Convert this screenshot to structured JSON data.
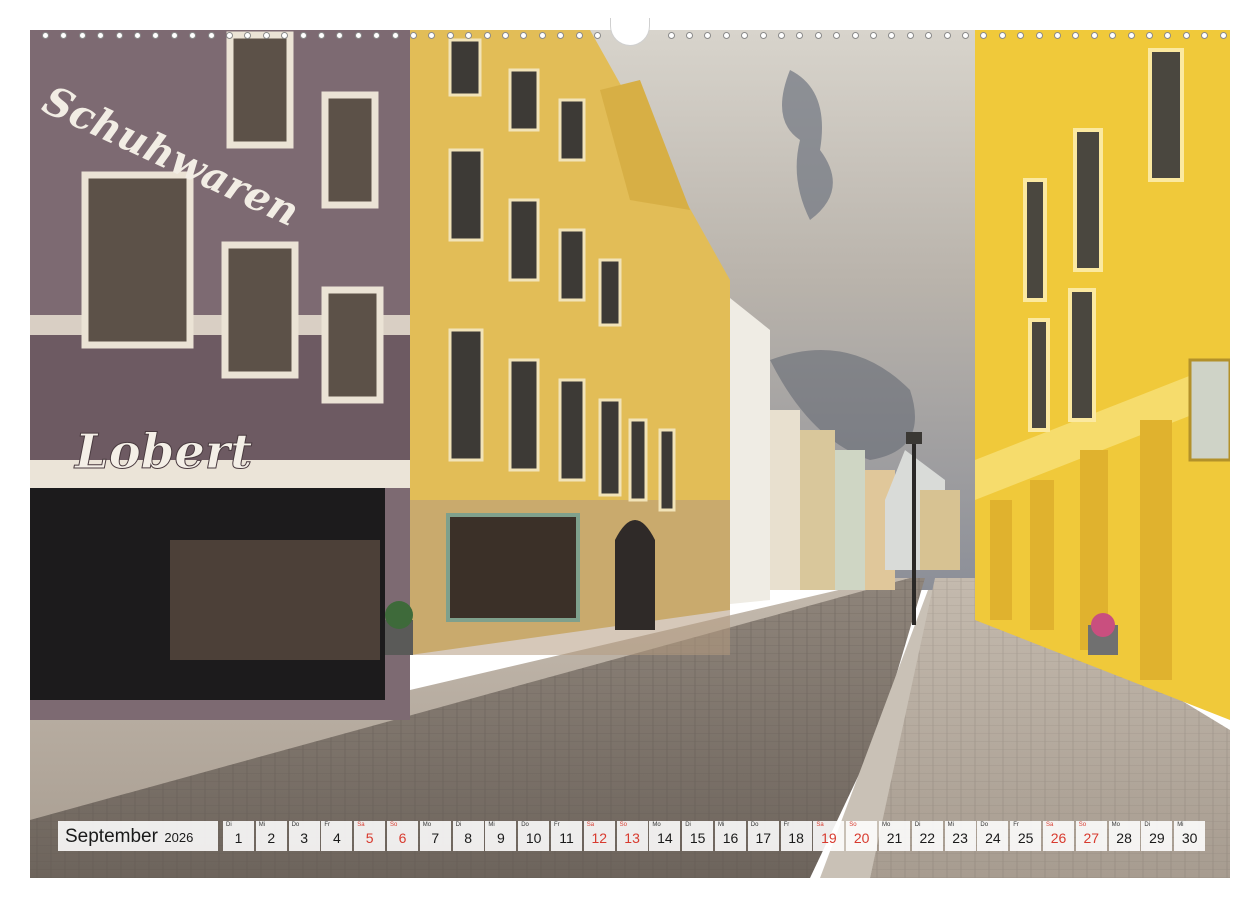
{
  "photo": {
    "description_label": "",
    "storefront": {
      "upper_sign": "Schuhwaren",
      "lower_sign": "Lobert"
    }
  },
  "calendar": {
    "month": "September",
    "year": "2026",
    "days": [
      {
        "num": "1",
        "abbr": "Di",
        "weekend": false
      },
      {
        "num": "2",
        "abbr": "Mi",
        "weekend": false
      },
      {
        "num": "3",
        "abbr": "Do",
        "weekend": false
      },
      {
        "num": "4",
        "abbr": "Fr",
        "weekend": false
      },
      {
        "num": "5",
        "abbr": "Sa",
        "weekend": true
      },
      {
        "num": "6",
        "abbr": "So",
        "weekend": true
      },
      {
        "num": "7",
        "abbr": "Mo",
        "weekend": false
      },
      {
        "num": "8",
        "abbr": "Di",
        "weekend": false
      },
      {
        "num": "9",
        "abbr": "Mi",
        "weekend": false
      },
      {
        "num": "10",
        "abbr": "Do",
        "weekend": false
      },
      {
        "num": "11",
        "abbr": "Fr",
        "weekend": false
      },
      {
        "num": "12",
        "abbr": "Sa",
        "weekend": true
      },
      {
        "num": "13",
        "abbr": "So",
        "weekend": true
      },
      {
        "num": "14",
        "abbr": "Mo",
        "weekend": false
      },
      {
        "num": "15",
        "abbr": "Di",
        "weekend": false
      },
      {
        "num": "16",
        "abbr": "Mi",
        "weekend": false
      },
      {
        "num": "17",
        "abbr": "Do",
        "weekend": false
      },
      {
        "num": "18",
        "abbr": "Fr",
        "weekend": false
      },
      {
        "num": "19",
        "abbr": "Sa",
        "weekend": true
      },
      {
        "num": "20",
        "abbr": "So",
        "weekend": true
      },
      {
        "num": "21",
        "abbr": "Mo",
        "weekend": false
      },
      {
        "num": "22",
        "abbr": "Di",
        "weekend": false
      },
      {
        "num": "23",
        "abbr": "Mi",
        "weekend": false
      },
      {
        "num": "24",
        "abbr": "Do",
        "weekend": false
      },
      {
        "num": "25",
        "abbr": "Fr",
        "weekend": false
      },
      {
        "num": "26",
        "abbr": "Sa",
        "weekend": true
      },
      {
        "num": "27",
        "abbr": "So",
        "weekend": true
      },
      {
        "num": "28",
        "abbr": "Mo",
        "weekend": false
      },
      {
        "num": "29",
        "abbr": "Di",
        "weekend": false
      },
      {
        "num": "30",
        "abbr": "Mi",
        "weekend": false
      }
    ],
    "weekend_color": "#d83a2e",
    "text_color": "#1a1a1a"
  },
  "colors": {
    "purple_facade": "#7d6a72",
    "yellow_facade": "#e6c24a",
    "bright_yellow": "#f0c93a",
    "sky": "#c9c5bf",
    "cobblestone": "#8a7f74",
    "sidewalk": "#b8ada0"
  }
}
